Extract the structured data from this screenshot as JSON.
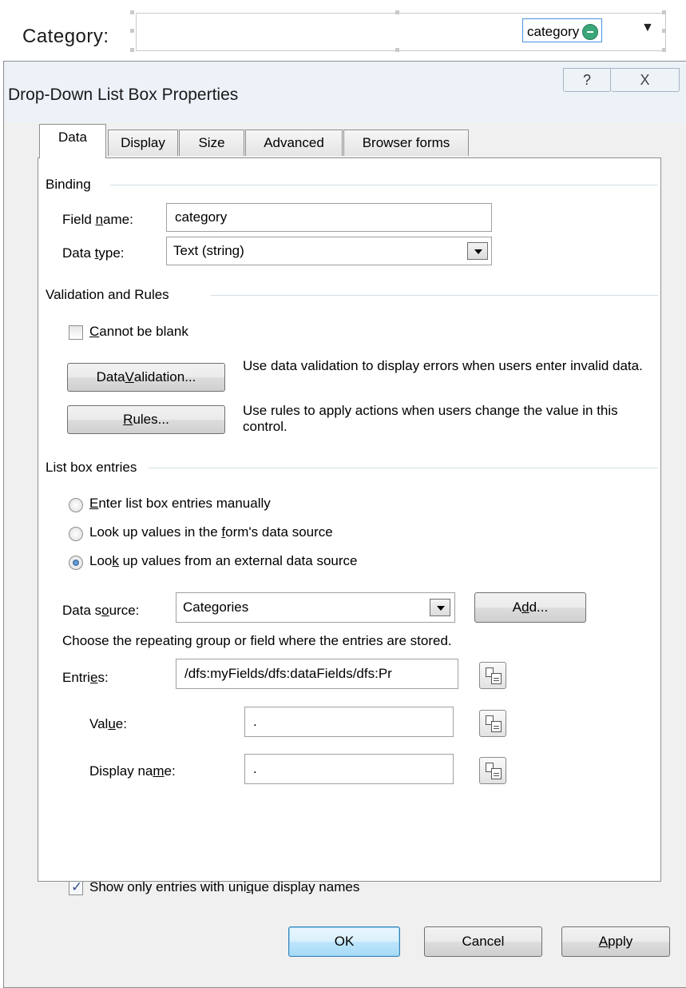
{
  "form_control": {
    "label": "Category:",
    "field_tag": "category"
  },
  "dialog": {
    "title": "Drop-Down List Box Properties",
    "help_glyph": "?",
    "close_glyph": "X",
    "tabs": [
      {
        "label": "Data",
        "active": true
      },
      {
        "label": "Display",
        "active": false
      },
      {
        "label": "Size",
        "active": false
      },
      {
        "label": "Advanced",
        "active": false
      },
      {
        "label": "Browser forms",
        "active": false
      }
    ],
    "binding": {
      "group_label": "Binding",
      "field_name_label": "Field name:",
      "field_name_value": "category",
      "data_type_label": "Data type:",
      "data_type_value": "Text (string)"
    },
    "validation": {
      "group_label": "Validation and Rules",
      "cannot_be_blank_label": "Cannot be blank",
      "cannot_be_blank_checked": false,
      "data_validation_button": "Data Validation...",
      "data_validation_desc": "Use data validation to display errors when users enter invalid data.",
      "rules_button": "Rules...",
      "rules_desc": "Use rules to apply actions when users change the value in this control."
    },
    "list_entries": {
      "group_label": "List box entries",
      "options": [
        {
          "label": "Enter list box entries manually",
          "selected": false
        },
        {
          "label": "Look up values in the form's data source",
          "selected": false
        },
        {
          "label": "Look up values from an external data source",
          "selected": true
        }
      ],
      "data_source_label": "Data source:",
      "data_source_value": "Categories",
      "add_button": "Add...",
      "instructions": "Choose the repeating group or field where the entries are stored.",
      "entries_label": "Entries:",
      "entries_value": "/dfs:myFields/dfs:dataFields/dfs:Pr",
      "value_label": "Value:",
      "value_value": ".",
      "display_name_label": "Display name:",
      "display_name_value": ".",
      "unique_names_label": "Show only entries with unique display names",
      "unique_names_checked": true
    },
    "footer": {
      "ok_button": "OK",
      "cancel_button": "Cancel",
      "apply_button": "Apply"
    }
  },
  "colors": {
    "dialog_bg": "#f0f0f0",
    "titlebar_bg": "#ecf2f8",
    "default_button_border": "#3c7fb1",
    "group_line": "#d5dfe5"
  },
  "icons": [
    "help-icon",
    "close-icon",
    "dropdown-arrow-icon",
    "xpath-selector-icon",
    "field-status-icon"
  ]
}
